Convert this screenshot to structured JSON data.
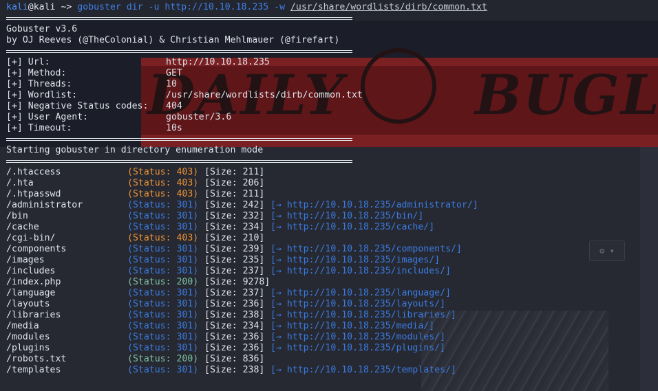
{
  "prompt": {
    "user": "kali",
    "at": "@",
    "host": "kali",
    "path": "~>",
    "command": "gobuster",
    "args": "dir -u http://10.10.18.235 -w",
    "wordlist_arg": "/usr/share/wordlists/dirb/common.txt"
  },
  "header": {
    "version": "Gobuster v3.6",
    "authors": "by OJ Reeves (@TheColonial) & Christian Mehlmauer (@firefart)"
  },
  "config": [
    {
      "label": "[+] Url:",
      "value": "http://10.10.18.235"
    },
    {
      "label": "[+] Method:",
      "value": "GET"
    },
    {
      "label": "[+] Threads:",
      "value": "10"
    },
    {
      "label": "[+] Wordlist:",
      "value": "/usr/share/wordlists/dirb/common.txt"
    },
    {
      "label": "[+] Negative Status codes:",
      "value": "404"
    },
    {
      "label": "[+] User Agent:",
      "value": "gobuster/3.6"
    },
    {
      "label": "[+] Timeout:",
      "value": "10s"
    }
  ],
  "start_message": "Starting gobuster in directory enumeration mode",
  "results": [
    {
      "path": "/.htaccess",
      "status": "(Status: 403)",
      "code": 403,
      "size": "[Size: 211]",
      "redirect": ""
    },
    {
      "path": "/.hta",
      "status": "(Status: 403)",
      "code": 403,
      "size": "[Size: 206]",
      "redirect": ""
    },
    {
      "path": "/.htpasswd",
      "status": "(Status: 403)",
      "code": 403,
      "size": "[Size: 211]",
      "redirect": ""
    },
    {
      "path": "/administrator",
      "status": "(Status: 301)",
      "code": 301,
      "size": "[Size: 242]",
      "redirect": "[→ http://10.10.18.235/administrator/]"
    },
    {
      "path": "/bin",
      "status": "(Status: 301)",
      "code": 301,
      "size": "[Size: 232]",
      "redirect": "[→ http://10.10.18.235/bin/]"
    },
    {
      "path": "/cache",
      "status": "(Status: 301)",
      "code": 301,
      "size": "[Size: 234]",
      "redirect": "[→ http://10.10.18.235/cache/]"
    },
    {
      "path": "/cgi-bin/",
      "status": "(Status: 403)",
      "code": 403,
      "size": "[Size: 210]",
      "redirect": ""
    },
    {
      "path": "/components",
      "status": "(Status: 301)",
      "code": 301,
      "size": "[Size: 239]",
      "redirect": "[→ http://10.10.18.235/components/]"
    },
    {
      "path": "/images",
      "status": "(Status: 301)",
      "code": 301,
      "size": "[Size: 235]",
      "redirect": "[→ http://10.10.18.235/images/]"
    },
    {
      "path": "/includes",
      "status": "(Status: 301)",
      "code": 301,
      "size": "[Size: 237]",
      "redirect": "[→ http://10.10.18.235/includes/]"
    },
    {
      "path": "/index.php",
      "status": "(Status: 200)",
      "code": 200,
      "size": "[Size: 9278]",
      "redirect": ""
    },
    {
      "path": "/language",
      "status": "(Status: 301)",
      "code": 301,
      "size": "[Size: 237]",
      "redirect": "[→ http://10.10.18.235/language/]"
    },
    {
      "path": "/layouts",
      "status": "(Status: 301)",
      "code": 301,
      "size": "[Size: 236]",
      "redirect": "[→ http://10.10.18.235/layouts/]"
    },
    {
      "path": "/libraries",
      "status": "(Status: 301)",
      "code": 301,
      "size": "[Size: 238]",
      "redirect": "[→ http://10.10.18.235/libraries/]"
    },
    {
      "path": "/media",
      "status": "(Status: 301)",
      "code": 301,
      "size": "[Size: 234]",
      "redirect": "[→ http://10.10.18.235/media/]"
    },
    {
      "path": "/modules",
      "status": "(Status: 301)",
      "code": 301,
      "size": "[Size: 236]",
      "redirect": "[→ http://10.10.18.235/modules/]"
    },
    {
      "path": "/plugins",
      "status": "(Status: 301)",
      "code": 301,
      "size": "[Size: 236]",
      "redirect": "[→ http://10.10.18.235/plugins/]"
    },
    {
      "path": "/robots.txt",
      "status": "(Status: 200)",
      "code": 200,
      "size": "[Size: 836]",
      "redirect": ""
    },
    {
      "path": "/templates",
      "status": "(Status: 301)",
      "code": 301,
      "size": "[Size: 238]",
      "redirect": "[→ http://10.10.18.235/templates/]"
    }
  ],
  "background": {
    "banner_left": "DAILY",
    "banner_right": "BUGLI"
  },
  "colors": {
    "status_403": "#ee9336",
    "status_301": "#3b7be0",
    "status_200": "#7fc1a2"
  }
}
